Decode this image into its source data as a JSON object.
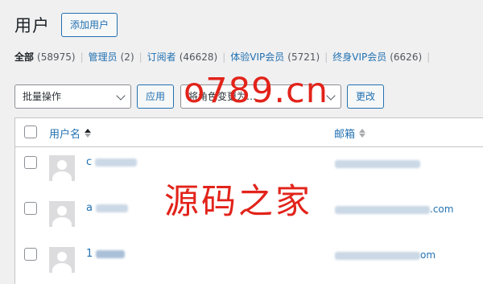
{
  "header": {
    "title": "用户",
    "add_label": "添加用户"
  },
  "filters": [
    {
      "label": "全部",
      "count": "(58975)",
      "current": true
    },
    {
      "label": "管理员",
      "count": "(2)"
    },
    {
      "label": "订阅者",
      "count": "(46628)"
    },
    {
      "label": "体验VIP会员",
      "count": "(5721)"
    },
    {
      "label": "终身VIP会员",
      "count": "(6626)"
    }
  ],
  "actions": {
    "bulk_select": "批量操作",
    "apply_label": "应用",
    "role_select": "将角色变更为…",
    "change_label": "更改"
  },
  "table": {
    "col_username": "用户名",
    "col_email": "邮箱",
    "rows": [
      {
        "username_prefix": "c",
        "email_suffix": ""
      },
      {
        "username_prefix": "a",
        "email_suffix": ".com"
      },
      {
        "username_prefix": "1",
        "email_suffix": "om"
      }
    ]
  },
  "watermarks": {
    "top": "o789.cn",
    "center": "源码之家"
  },
  "colors": {
    "accent": "#2271b1",
    "watermark": "#e2231a",
    "background": "#f0f0f1"
  }
}
